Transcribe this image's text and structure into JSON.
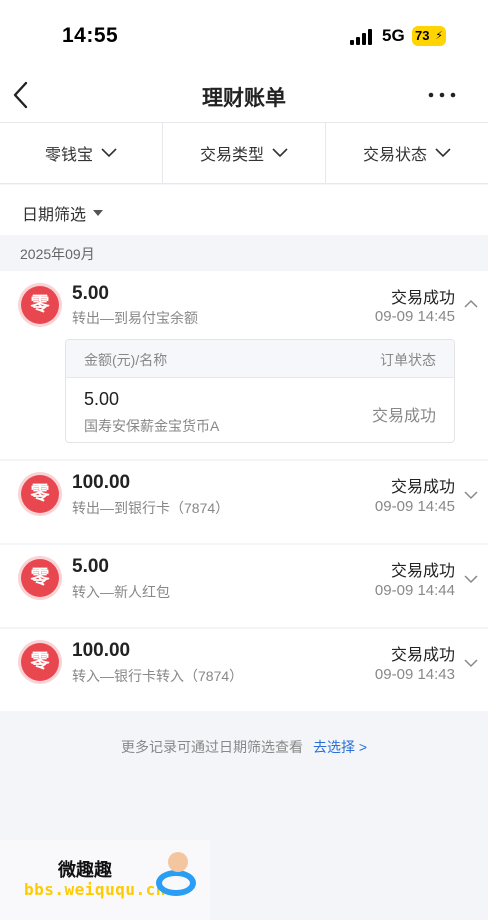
{
  "status_bar": {
    "time": "14:55",
    "network": "5G",
    "battery": "73"
  },
  "nav": {
    "title": "理财账单"
  },
  "filters": [
    "零钱宝",
    "交易类型",
    "交易状态"
  ],
  "date_filter": {
    "label": "日期筛选"
  },
  "month": "2025年09月",
  "records": [
    {
      "icon": "零",
      "amount": "5.00",
      "desc": "转出—到易付宝余额",
      "status": "交易成功",
      "time": "09-09 14:45",
      "expanded": true
    },
    {
      "icon": "零",
      "amount": "100.00",
      "desc": "转出—到银行卡（7874）",
      "status": "交易成功",
      "time": "09-09 14:45",
      "expanded": false
    },
    {
      "icon": "零",
      "amount": "5.00",
      "desc": "转入—新人红包",
      "status": "交易成功",
      "time": "09-09 14:44",
      "expanded": false
    },
    {
      "icon": "零",
      "amount": "100.00",
      "desc": "转入—银行卡转入（7874）",
      "status": "交易成功",
      "time": "09-09 14:43",
      "expanded": false
    }
  ],
  "detail": {
    "col_left": "金额(元)/名称",
    "col_right": "订单状态",
    "amount": "5.00",
    "name": "国寿安保薪金宝货币A",
    "status": "交易成功"
  },
  "footer": {
    "tip": "更多记录可通过日期筛选查看",
    "link": "去选择 >"
  },
  "watermark": {
    "title": "微趣趣",
    "url": "bbs.weiququ.cn"
  },
  "colors": {
    "logo": "#e8474f",
    "link": "#2a6fd6",
    "battery": "#ffd400"
  }
}
